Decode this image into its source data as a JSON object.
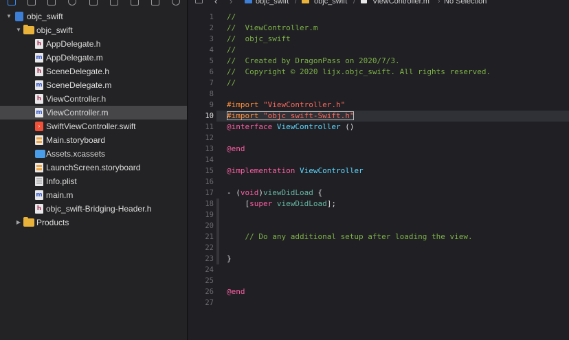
{
  "navigator": {
    "tree": [
      {
        "label": "objc_swift",
        "type": "project",
        "indent": 0,
        "disclosure": "open",
        "selected": false
      },
      {
        "label": "objc_swift",
        "type": "folder",
        "indent": 1,
        "disclosure": "open",
        "selected": false
      },
      {
        "label": "AppDelegate.h",
        "type": "h",
        "indent": 2,
        "selected": false
      },
      {
        "label": "AppDelegate.m",
        "type": "m",
        "indent": 2,
        "selected": false
      },
      {
        "label": "SceneDelegate.h",
        "type": "h",
        "indent": 2,
        "selected": false
      },
      {
        "label": "SceneDelegate.m",
        "type": "m",
        "indent": 2,
        "selected": false
      },
      {
        "label": "ViewController.h",
        "type": "h",
        "indent": 2,
        "selected": false
      },
      {
        "label": "ViewController.m",
        "type": "m",
        "indent": 2,
        "selected": true
      },
      {
        "label": "SwiftViewController.swift",
        "type": "swift",
        "indent": 2,
        "selected": false
      },
      {
        "label": "Main.storyboard",
        "type": "storyboard",
        "indent": 2,
        "selected": false
      },
      {
        "label": "Assets.xcassets",
        "type": "assets",
        "indent": 2,
        "selected": false
      },
      {
        "label": "LaunchScreen.storyboard",
        "type": "storyboard",
        "indent": 2,
        "selected": false
      },
      {
        "label": "Info.plist",
        "type": "plist",
        "indent": 2,
        "selected": false
      },
      {
        "label": "main.m",
        "type": "m",
        "indent": 2,
        "selected": false
      },
      {
        "label": "objc_swift-Bridging-Header.h",
        "type": "h",
        "indent": 2,
        "selected": false
      },
      {
        "label": "Products",
        "type": "folder",
        "indent": 1,
        "disclosure": "closed",
        "selected": false
      }
    ]
  },
  "jumpbar": {
    "back_icon": "chevron-left-icon",
    "forward_icon": "chevron-right-icon",
    "crumbs": [
      "objc_swift",
      "objc_swift",
      "ViewController.m",
      "No Selection"
    ]
  },
  "editor": {
    "current_line": 10,
    "lines": [
      [
        {
          "t": "//",
          "c": "cm"
        }
      ],
      [
        {
          "t": "//  ViewController.m",
          "c": "cm"
        }
      ],
      [
        {
          "t": "//  objc_swift",
          "c": "cm"
        }
      ],
      [
        {
          "t": "//",
          "c": "cm"
        }
      ],
      [
        {
          "t": "//  Created by DragonPass on 2020/7/3.",
          "c": "cm"
        }
      ],
      [
        {
          "t": "//  Copyright © 2020 lijx.objc_swift. All rights reserved.",
          "c": "cm"
        }
      ],
      [
        {
          "t": "//",
          "c": "cm"
        }
      ],
      [],
      [
        {
          "t": "#import ",
          "c": "pp"
        },
        {
          "t": "\"ViewController.h\"",
          "c": "st"
        }
      ],
      [
        {
          "t": "#import ",
          "c": "pp"
        },
        {
          "t": "\"objc_swift-Swift.h\"",
          "c": "st"
        }
      ],
      [
        {
          "t": "@interface ",
          "c": "kw"
        },
        {
          "t": "ViewController",
          "c": "cls"
        },
        {
          "t": " ()",
          "c": ""
        }
      ],
      [],
      [
        {
          "t": "@end",
          "c": "kw"
        }
      ],
      [],
      [
        {
          "t": "@implementation ",
          "c": "kw"
        },
        {
          "t": "ViewController",
          "c": "cls"
        }
      ],
      [],
      [
        {
          "t": "- (",
          "c": ""
        },
        {
          "t": "void",
          "c": "kw"
        },
        {
          "t": ")",
          "c": ""
        },
        {
          "t": "viewDidLoad",
          "c": "cls2"
        },
        {
          "t": " {",
          "c": ""
        }
      ],
      [
        {
          "t": "    [",
          "c": ""
        },
        {
          "t": "super",
          "c": "kw"
        },
        {
          "t": " ",
          "c": ""
        },
        {
          "t": "viewDidLoad",
          "c": "cls2"
        },
        {
          "t": "];",
          "c": ""
        }
      ],
      [],
      [],
      [
        {
          "t": "    // Do any additional setup after loading the view.",
          "c": "cm"
        }
      ],
      [],
      [
        {
          "t": "}",
          "c": ""
        }
      ],
      [],
      [],
      [
        {
          "t": "@end",
          "c": "kw"
        }
      ],
      []
    ]
  }
}
